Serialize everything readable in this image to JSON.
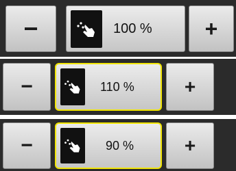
{
  "controls": [
    {
      "minus_label": "−",
      "plus_label": "+",
      "value_text": "100 %",
      "selected": false,
      "icon": "hand-press-icon"
    },
    {
      "minus_label": "−",
      "plus_label": "+",
      "value_text": "110 %",
      "selected": true,
      "icon": "hand-press-icon"
    },
    {
      "minus_label": "−",
      "plus_label": "+",
      "value_text": "90 %",
      "selected": true,
      "icon": "hand-press-icon"
    }
  ],
  "colors": {
    "strip": "#2b2b2b",
    "button": "#d6d6d6",
    "selection": "#f2e600",
    "icon_bg": "#111111"
  }
}
